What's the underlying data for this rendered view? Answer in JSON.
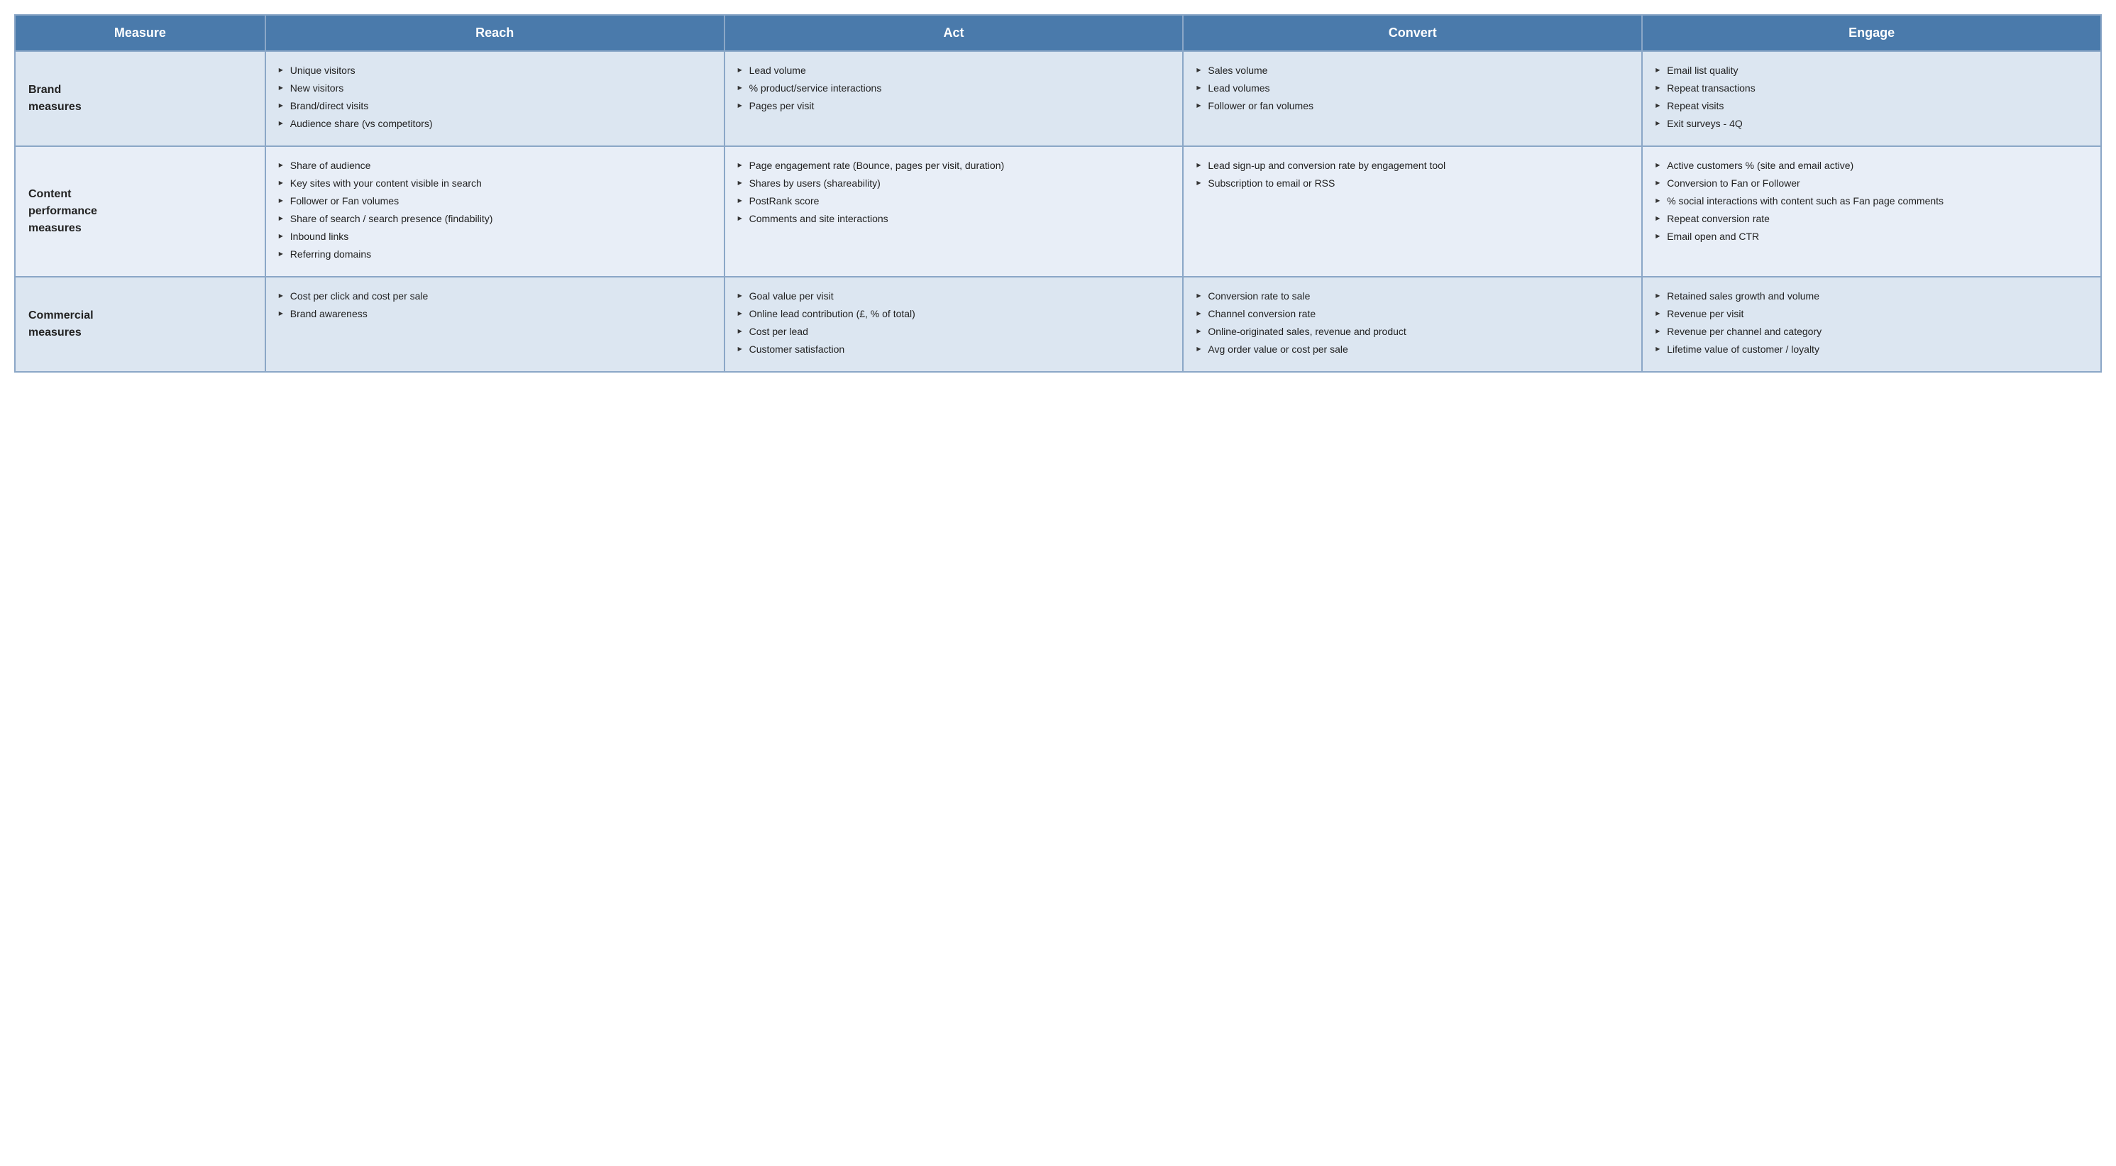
{
  "table": {
    "headers": [
      "Measure",
      "Reach",
      "Act",
      "Convert",
      "Engage"
    ],
    "rows": [
      {
        "rowHeader": "Brand\nmeasures",
        "reach": [
          "Unique visitors",
          "New visitors",
          "Brand/direct visits",
          "Audience share (vs competitors)"
        ],
        "act": [
          "Lead volume",
          "% product/service interactions",
          "Pages per visit"
        ],
        "convert": [
          "Sales volume",
          "Lead volumes",
          "Follower or fan volumes"
        ],
        "engage": [
          "Email list quality",
          "Repeat transactions",
          "Repeat visits",
          "Exit surveys - 4Q"
        ]
      },
      {
        "rowHeader": "Content\nperformance\nmeasures",
        "reach": [
          "Share of audience",
          "Key sites with your content visible in search",
          "Follower or Fan volumes",
          "Share of search / search presence (findability)",
          "Inbound links",
          "Referring domains"
        ],
        "act": [
          "Page engagement rate (Bounce, pages per visit, duration)",
          "Shares by users (shareability)",
          "PostRank score",
          "Comments and site interactions"
        ],
        "convert": [
          "Lead sign-up and conversion rate by engagement tool",
          "Subscription to email or RSS"
        ],
        "engage": [
          "Active customers % (site and email active)",
          "Conversion to Fan or Follower",
          "% social interactions with content such as Fan page comments",
          "Repeat conversion rate",
          "Email open and CTR"
        ]
      },
      {
        "rowHeader": "Commercial\nmeasures",
        "reach": [
          "Cost per click and cost per sale",
          "Brand awareness"
        ],
        "act": [
          "Goal value per visit",
          "Online lead contribution (£, % of total)",
          "Cost per lead",
          "Customer satisfaction"
        ],
        "convert": [
          "Conversion rate to sale",
          "Channel conversion rate",
          "Online-originated sales, revenue and product",
          "Avg order value or cost per sale"
        ],
        "engage": [
          "Retained sales growth and volume",
          "Revenue per visit",
          "Revenue per channel and category",
          "Lifetime value of customer / loyalty"
        ]
      }
    ]
  }
}
